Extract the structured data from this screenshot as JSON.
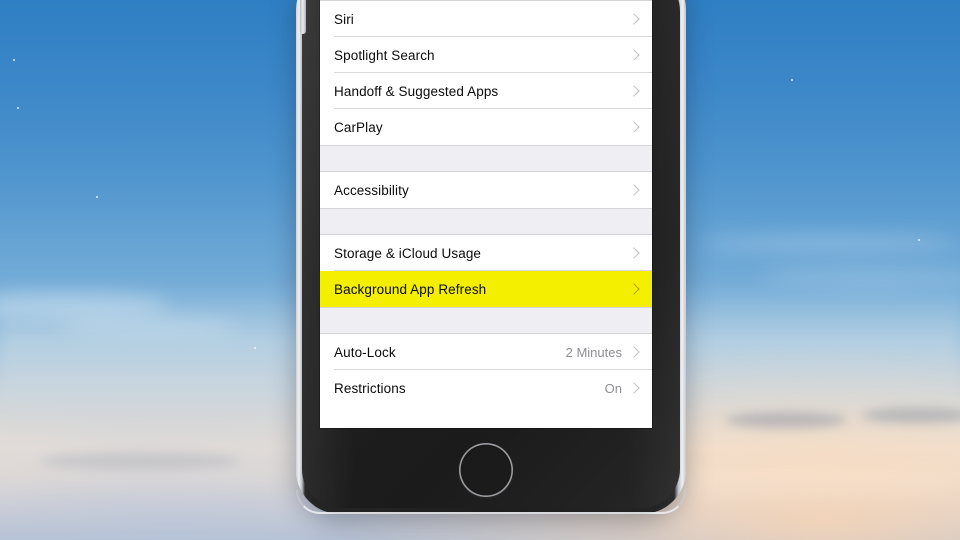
{
  "wallpaper": {
    "description": "sky-gradient-wallpaper",
    "top_color": "#2f7fc4",
    "bottom_color": "#aab6cb",
    "warm_accent": "#ffd6b0"
  },
  "device": {
    "name": "iPhone",
    "body_color": "#1e1e1e",
    "rim_color": "#eef0f2",
    "home_button_label": "Home",
    "volume_button_label": "Volume Up"
  },
  "screen": {
    "app": "Settings",
    "highlight_color": "#f4ef00",
    "separator_color": "#d9d8dd",
    "group_background": "#efeef3",
    "value_text_color": "#8e8e93",
    "chevron_icon": "chevron-right-icon",
    "groups": [
      {
        "id": "group-siri",
        "rows": [
          {
            "label": "Siri",
            "value": "",
            "highlight": false
          },
          {
            "label": "Spotlight Search",
            "value": "",
            "highlight": false
          },
          {
            "label": "Handoff & Suggested Apps",
            "value": "",
            "highlight": false
          },
          {
            "label": "CarPlay",
            "value": "",
            "highlight": false
          }
        ]
      },
      {
        "id": "group-accessibility",
        "rows": [
          {
            "label": "Accessibility",
            "value": "",
            "highlight": false
          }
        ]
      },
      {
        "id": "group-storage",
        "rows": [
          {
            "label": "Storage & iCloud Usage",
            "value": "",
            "highlight": false
          },
          {
            "label": "Background App Refresh",
            "value": "",
            "highlight": true
          }
        ]
      },
      {
        "id": "group-lock",
        "rows": [
          {
            "label": "Auto-Lock",
            "value": "2 Minutes",
            "highlight": false
          },
          {
            "label": "Restrictions",
            "value": "On",
            "highlight": false
          }
        ]
      }
    ]
  }
}
